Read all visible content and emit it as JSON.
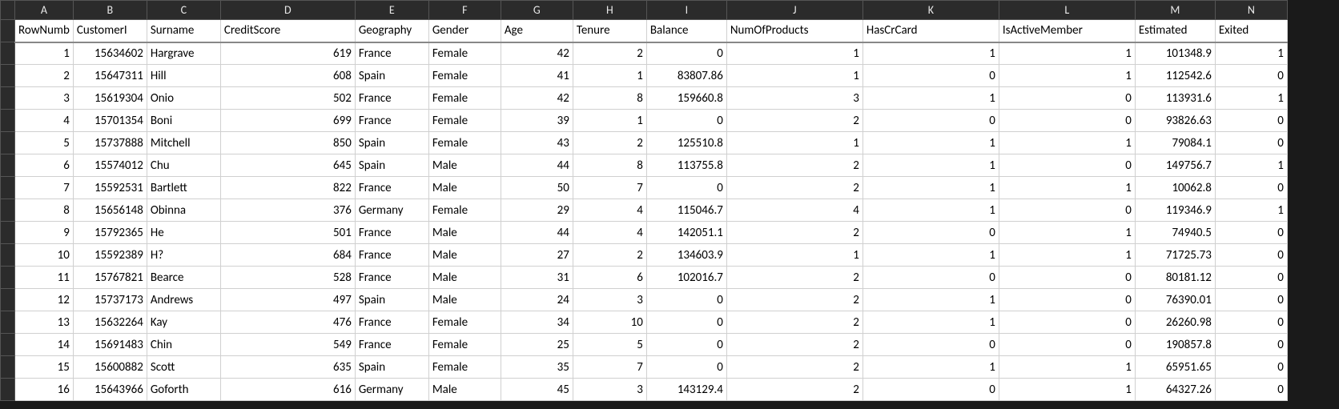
{
  "columns": [
    "A",
    "B",
    "C",
    "D",
    "E",
    "F",
    "G",
    "H",
    "I",
    "J",
    "K",
    "L",
    "M",
    "N"
  ],
  "headers": {
    "A": "RowNumb",
    "B": "CustomerI",
    "C": "Surname",
    "D": "CreditScore",
    "E": "Geography",
    "F": "Gender",
    "G": "Age",
    "H": "Tenure",
    "I": "Balance",
    "J": "NumOfProducts",
    "K": "HasCrCard",
    "L": "IsActiveMember",
    "M": "Estimated",
    "N": "Exited"
  },
  "rows": [
    {
      "A": "1",
      "B": "15634602",
      "C": "Hargrave",
      "D": "619",
      "E": "France",
      "F": "Female",
      "G": "42",
      "H": "2",
      "I": "0",
      "J": "1",
      "K": "1",
      "L": "1",
      "M": "101348.9",
      "N": "1"
    },
    {
      "A": "2",
      "B": "15647311",
      "C": "Hill",
      "D": "608",
      "E": "Spain",
      "F": "Female",
      "G": "41",
      "H": "1",
      "I": "83807.86",
      "J": "1",
      "K": "0",
      "L": "1",
      "M": "112542.6",
      "N": "0"
    },
    {
      "A": "3",
      "B": "15619304",
      "C": "Onio",
      "D": "502",
      "E": "France",
      "F": "Female",
      "G": "42",
      "H": "8",
      "I": "159660.8",
      "J": "3",
      "K": "1",
      "L": "0",
      "M": "113931.6",
      "N": "1"
    },
    {
      "A": "4",
      "B": "15701354",
      "C": "Boni",
      "D": "699",
      "E": "France",
      "F": "Female",
      "G": "39",
      "H": "1",
      "I": "0",
      "J": "2",
      "K": "0",
      "L": "0",
      "M": "93826.63",
      "N": "0"
    },
    {
      "A": "5",
      "B": "15737888",
      "C": "Mitchell",
      "D": "850",
      "E": "Spain",
      "F": "Female",
      "G": "43",
      "H": "2",
      "I": "125510.8",
      "J": "1",
      "K": "1",
      "L": "1",
      "M": "79084.1",
      "N": "0"
    },
    {
      "A": "6",
      "B": "15574012",
      "C": "Chu",
      "D": "645",
      "E": "Spain",
      "F": "Male",
      "G": "44",
      "H": "8",
      "I": "113755.8",
      "J": "2",
      "K": "1",
      "L": "0",
      "M": "149756.7",
      "N": "1"
    },
    {
      "A": "7",
      "B": "15592531",
      "C": "Bartlett",
      "D": "822",
      "E": "France",
      "F": "Male",
      "G": "50",
      "H": "7",
      "I": "0",
      "J": "2",
      "K": "1",
      "L": "1",
      "M": "10062.8",
      "N": "0"
    },
    {
      "A": "8",
      "B": "15656148",
      "C": "Obinna",
      "D": "376",
      "E": "Germany",
      "F": "Female",
      "G": "29",
      "H": "4",
      "I": "115046.7",
      "J": "4",
      "K": "1",
      "L": "0",
      "M": "119346.9",
      "N": "1"
    },
    {
      "A": "9",
      "B": "15792365",
      "C": "He",
      "D": "501",
      "E": "France",
      "F": "Male",
      "G": "44",
      "H": "4",
      "I": "142051.1",
      "J": "2",
      "K": "0",
      "L": "1",
      "M": "74940.5",
      "N": "0"
    },
    {
      "A": "10",
      "B": "15592389",
      "C": "H?",
      "D": "684",
      "E": "France",
      "F": "Male",
      "G": "27",
      "H": "2",
      "I": "134603.9",
      "J": "1",
      "K": "1",
      "L": "1",
      "M": "71725.73",
      "N": "0"
    },
    {
      "A": "11",
      "B": "15767821",
      "C": "Bearce",
      "D": "528",
      "E": "France",
      "F": "Male",
      "G": "31",
      "H": "6",
      "I": "102016.7",
      "J": "2",
      "K": "0",
      "L": "0",
      "M": "80181.12",
      "N": "0"
    },
    {
      "A": "12",
      "B": "15737173",
      "C": "Andrews",
      "D": "497",
      "E": "Spain",
      "F": "Male",
      "G": "24",
      "H": "3",
      "I": "0",
      "J": "2",
      "K": "1",
      "L": "0",
      "M": "76390.01",
      "N": "0"
    },
    {
      "A": "13",
      "B": "15632264",
      "C": "Kay",
      "D": "476",
      "E": "France",
      "F": "Female",
      "G": "34",
      "H": "10",
      "I": "0",
      "J": "2",
      "K": "1",
      "L": "0",
      "M": "26260.98",
      "N": "0"
    },
    {
      "A": "14",
      "B": "15691483",
      "C": "Chin",
      "D": "549",
      "E": "France",
      "F": "Female",
      "G": "25",
      "H": "5",
      "I": "0",
      "J": "2",
      "K": "0",
      "L": "0",
      "M": "190857.8",
      "N": "0"
    },
    {
      "A": "15",
      "B": "15600882",
      "C": "Scott",
      "D": "635",
      "E": "Spain",
      "F": "Female",
      "G": "35",
      "H": "7",
      "I": "0",
      "J": "2",
      "K": "1",
      "L": "1",
      "M": "65951.65",
      "N": "0"
    },
    {
      "A": "16",
      "B": "15643966",
      "C": "Goforth",
      "D": "616",
      "E": "Germany",
      "F": "Male",
      "G": "45",
      "H": "3",
      "I": "143129.4",
      "J": "2",
      "K": "0",
      "L": "1",
      "M": "64327.26",
      "N": "0"
    }
  ],
  "textCols": [
    "C",
    "E",
    "F"
  ]
}
